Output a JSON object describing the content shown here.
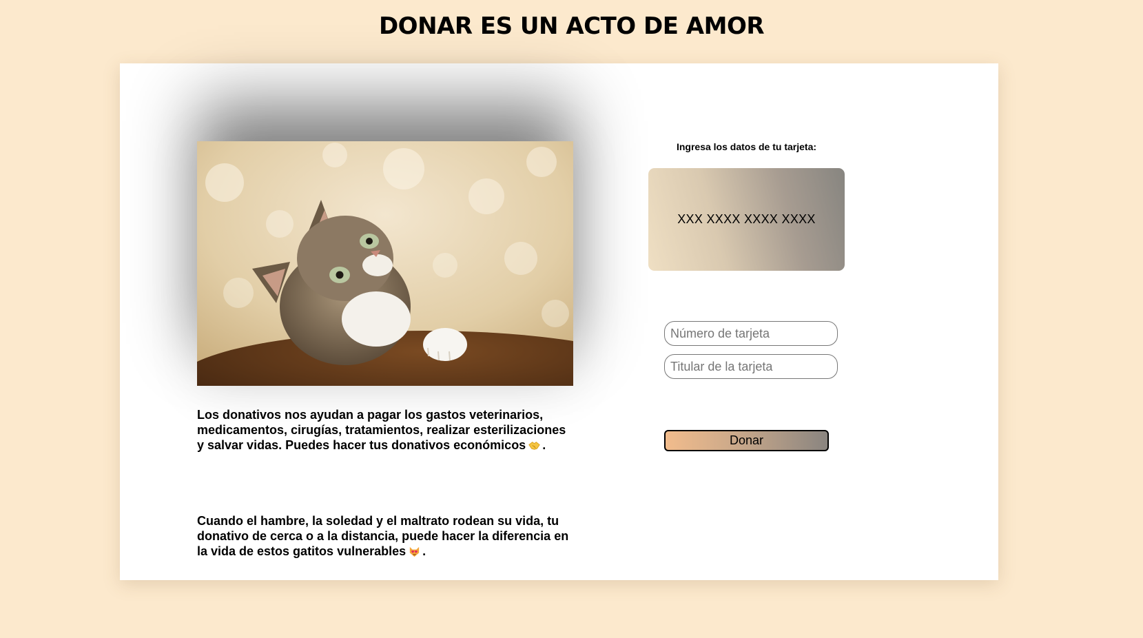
{
  "header": {
    "title": "DONAR ES UN ACTO DE AMOR"
  },
  "content": {
    "paragraph_1": "Los donativos nos ayudan a pagar los gastos veterinarios, medicamentos, cirugías, tratamientos, realizar esterilizaciones y salvar vidas. Puedes hacer tus donativos económicos",
    "paragraph_1_emoji": "handshake-emoji",
    "paragraph_1_end": ".",
    "paragraph_2": "Cuando el hambre, la soledad y el maltrato rodean su vida, tu donativo de cerca o a la distancia, puede hacer la diferencia en la vida de estos gatitos vulnerables",
    "paragraph_2_emoji": "heart-eyes-cat-emoji",
    "paragraph_2_end": "."
  },
  "form": {
    "label": "Ingresa los datos de tu tarjeta:",
    "card_preview": "XXX XXXX XXXX XXXX",
    "card_number_placeholder": "Número de tarjeta",
    "card_holder_placeholder": "Titular de la tarjeta",
    "submit_label": "Donar"
  },
  "colors": {
    "page_background": "#fce9cd",
    "panel_background": "#ffffff",
    "button_gradient_start": "#f2bc8c",
    "button_gradient_end": "#8a8580"
  }
}
